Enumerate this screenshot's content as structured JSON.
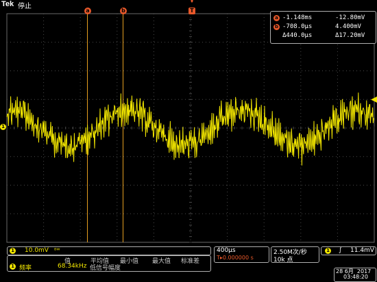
{
  "header": {
    "brand": "Tek",
    "status": "停止"
  },
  "cursors": {
    "a_label": "a",
    "b_label": "b",
    "trigger_label": "T",
    "a_time": "-1.148ms",
    "a_volt": "-12.80mV",
    "b_time": "-708.0µs",
    "b_volt": "4.400mV",
    "delta_time": "Δ440.0µs",
    "delta_volt": "Δ17.20mV"
  },
  "channel": {
    "label": "1",
    "scale": "10.0mV",
    "bandwidth_symbol": "ᴮᵂ"
  },
  "measurements": {
    "badge": "1",
    "name": "频率",
    "headers": [
      "值",
      "平均值",
      "最小值",
      "最大值",
      "标准差"
    ],
    "value": "68.34kHz",
    "note": "低信号幅度"
  },
  "horizontal": {
    "scale": "400µs",
    "trigger_pos": "T▸0.000000 s"
  },
  "acquisition": {
    "rate": "2.50M次/秒",
    "points": "10k 点"
  },
  "trigger": {
    "channel": "1",
    "slope": "∫",
    "level": "11.4mV"
  },
  "datetime": {
    "date": "28 6月  2017",
    "time": "03:48:20"
  },
  "colors": {
    "channel1": "#f2e600",
    "cursor": "#e8582a",
    "grid": "#4a4a4a",
    "border": "#b0b0b0"
  }
}
